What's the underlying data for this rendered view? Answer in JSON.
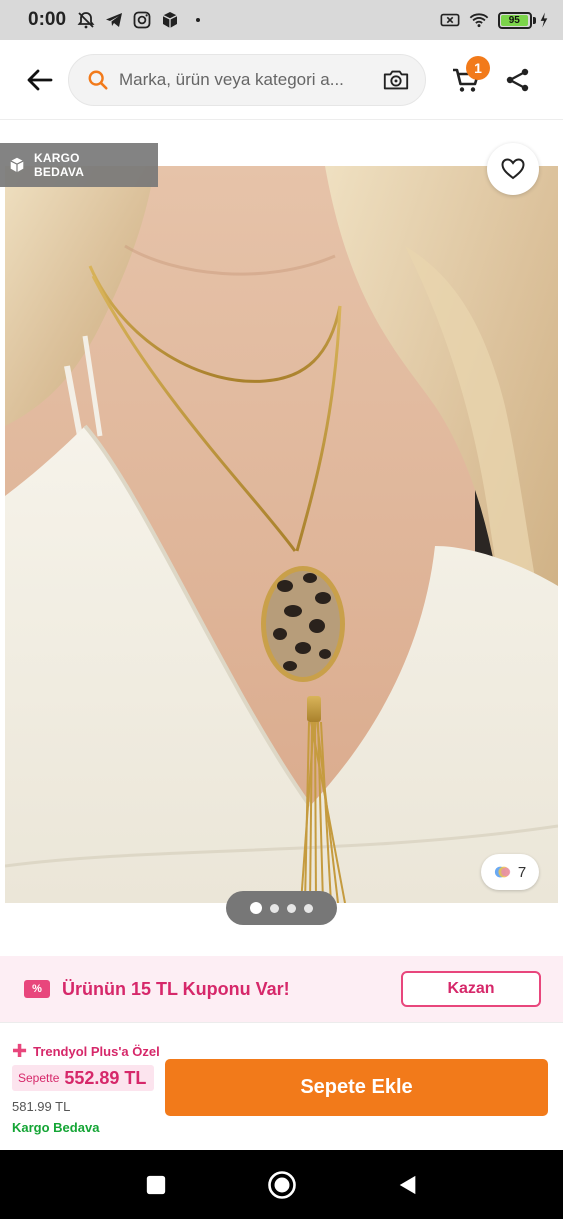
{
  "status_bar": {
    "time": "0:00",
    "left_icons": [
      "muted-bell-icon",
      "telegram-icon",
      "instagram-icon",
      "box-icon",
      "dot-icon"
    ],
    "right_icons": [
      "no-sim-icon",
      "wifi-icon",
      "battery-icon"
    ],
    "battery_level": "95"
  },
  "header": {
    "back_icon": "arrow-left-icon",
    "search": {
      "placeholder": "Marka, ürün veya kategori a...",
      "value": ""
    },
    "camera_icon": "camera-icon",
    "cart_icon": "cart-icon",
    "cart_count": "1",
    "share_icon": "share-icon"
  },
  "product": {
    "kargo_badge_line1": "KARGO",
    "kargo_badge_line2": "BEDAVA",
    "favorite_icon": "heart-icon",
    "variant_count": "7",
    "image_count": 4,
    "active_image": 1
  },
  "coupon": {
    "icon_text": "%",
    "text": "Ürünün 15 TL Kuponu Var!",
    "button_label": "Kazan"
  },
  "purchase": {
    "plus_label": "Trendyol Plus'a Özel",
    "sepette_label": "Sepette",
    "sepette_price": "552.89 TL",
    "old_price": "581.99 TL",
    "shipping": "Kargo Bedava",
    "add_to_cart_label": "Sepete Ekle"
  },
  "colors": {
    "brand_orange": "#f27a1a",
    "coupon_pink": "#d6286a",
    "shipping_green": "#14a535"
  }
}
